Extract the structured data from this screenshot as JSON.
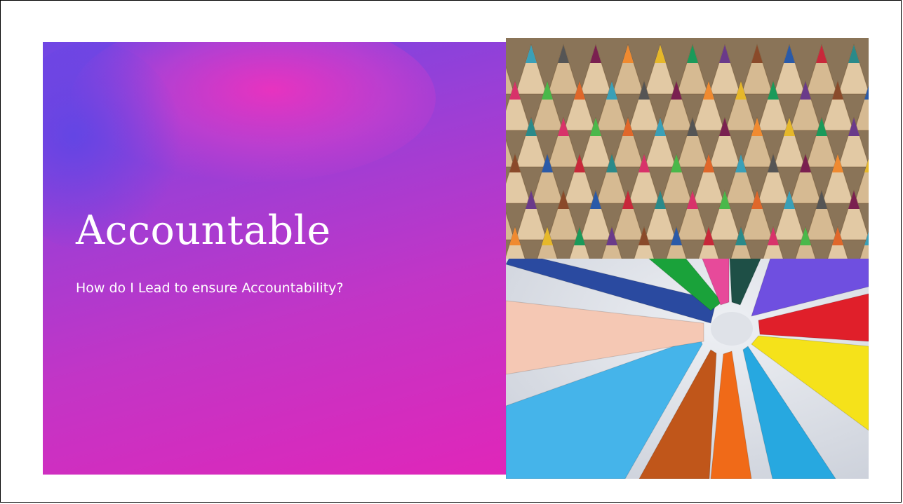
{
  "slide": {
    "title": "Accountable",
    "subtitle": "How do I Lead to ensure Accountability?"
  },
  "images": {
    "top_photo": "colored-pencil-tips-photo",
    "bottom_photo": "crayon-circle-photo"
  },
  "colors": {
    "panel_gradient_start": "#6f46e4",
    "panel_gradient_end": "#e026b9",
    "title_text": "#ffffff"
  }
}
